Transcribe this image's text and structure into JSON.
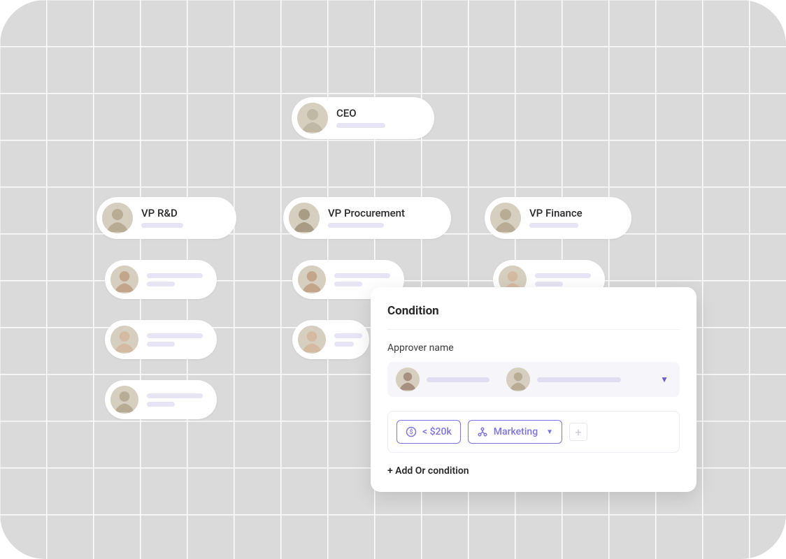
{
  "org": {
    "ceo": {
      "label": "CEO"
    },
    "vps": [
      {
        "label": "VP R&D"
      },
      {
        "label": "VP Procurement"
      },
      {
        "label": "VP Finance"
      }
    ]
  },
  "condition": {
    "title": "Condition",
    "approver_label": "Approver name",
    "tags": {
      "amount": "< $20k",
      "dept": "Marketing"
    },
    "add_or_label": "+ Add Or condition"
  }
}
